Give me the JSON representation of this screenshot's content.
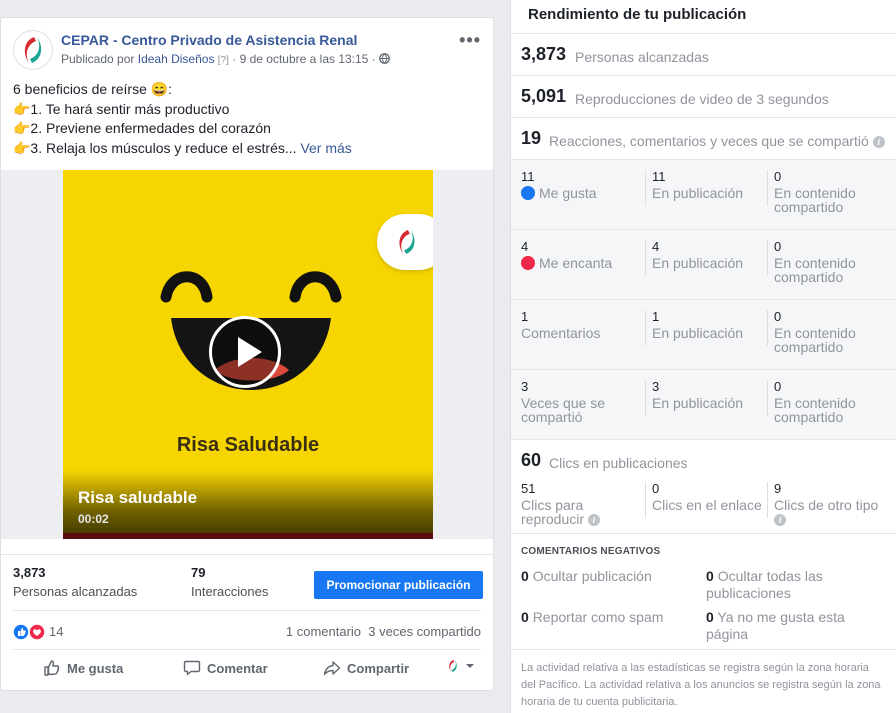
{
  "post": {
    "page_name": "CEPAR - Centro Privado de Asistencia Renal",
    "meta_prefix": "Publicado por",
    "author": "Ideah Diseños",
    "help_marker": "[?]",
    "date": "· 9 de octubre a las 13:15 ·",
    "text": {
      "line1": "6 beneficios de reírse 😄:",
      "line2": "👉1. Te hará sentir más productivo",
      "line3": "👉2. Previene enfermedades del corazón",
      "line4": "👉3. Relaja los músculos y reduce el estrés...",
      "see_more": "Ver más"
    },
    "video": {
      "center_title": "Risa Saludable",
      "title": "Risa saludable",
      "duration": "00:02"
    },
    "insights": {
      "reach_value": "3,873",
      "reach_label": "Personas alcanzadas",
      "interactions_value": "79",
      "interactions_label": "Interacciones",
      "promote_label": "Promocionar publicación"
    },
    "reactions": {
      "count": "14",
      "comments": "1 comentario",
      "shares": "3 veces compartido"
    },
    "actions": {
      "like": "Me gusta",
      "comment": "Comentar",
      "share": "Compartir"
    }
  },
  "panel": {
    "title": "Rendimiento de tu publicación",
    "reach": {
      "value": "3,873",
      "label": "Personas alcanzadas"
    },
    "views": {
      "value": "5,091",
      "label": "Reproducciones de video de 3 segundos"
    },
    "engagement": {
      "value": "19",
      "label": "Reacciones, comentarios y veces que se compartió"
    },
    "rows": [
      {
        "n1": "11",
        "l1": "Me gusta",
        "n2": "11",
        "l2": "En publicación",
        "n3": "0",
        "l3": "En contenido compartido"
      },
      {
        "n1": "4",
        "l1": "Me encanta",
        "n2": "4",
        "l2": "En publicación",
        "n3": "0",
        "l3": "En contenido compartido"
      },
      {
        "n1": "1",
        "l1": "Comentarios",
        "n2": "1",
        "l2": "En publicación",
        "n3": "0",
        "l3": "En contenido compartido"
      },
      {
        "n1": "3",
        "l1": "Veces que se compartió",
        "n2": "3",
        "l2": "En publicación",
        "n3": "0",
        "l3": "En contenido compartido"
      }
    ],
    "clicks": {
      "value": "60",
      "label": "Clics en publicaciones"
    },
    "click_rows": {
      "n1": "51",
      "l1": "Clics para reproducir",
      "n2": "0",
      "l2": "Clics en el enlace",
      "n3": "9",
      "l3": "Clics de otro tipo"
    },
    "negative": {
      "title": "COMENTARIOS NEGATIVOS",
      "hide_post_n": "0",
      "hide_post": "Ocultar publicación",
      "hide_all_n": "0",
      "hide_all": "Ocultar todas las publicaciones",
      "spam_n": "0",
      "spam": "Reportar como spam",
      "unlike_n": "0",
      "unlike": "Ya no me gusta esta página"
    },
    "footnote": "La actividad relativa a las estadísticas se registra según la zona horaria del Pacífico. La actividad relativa a los anuncios se registra según la zona horaria de tu cuenta publicitaria."
  }
}
